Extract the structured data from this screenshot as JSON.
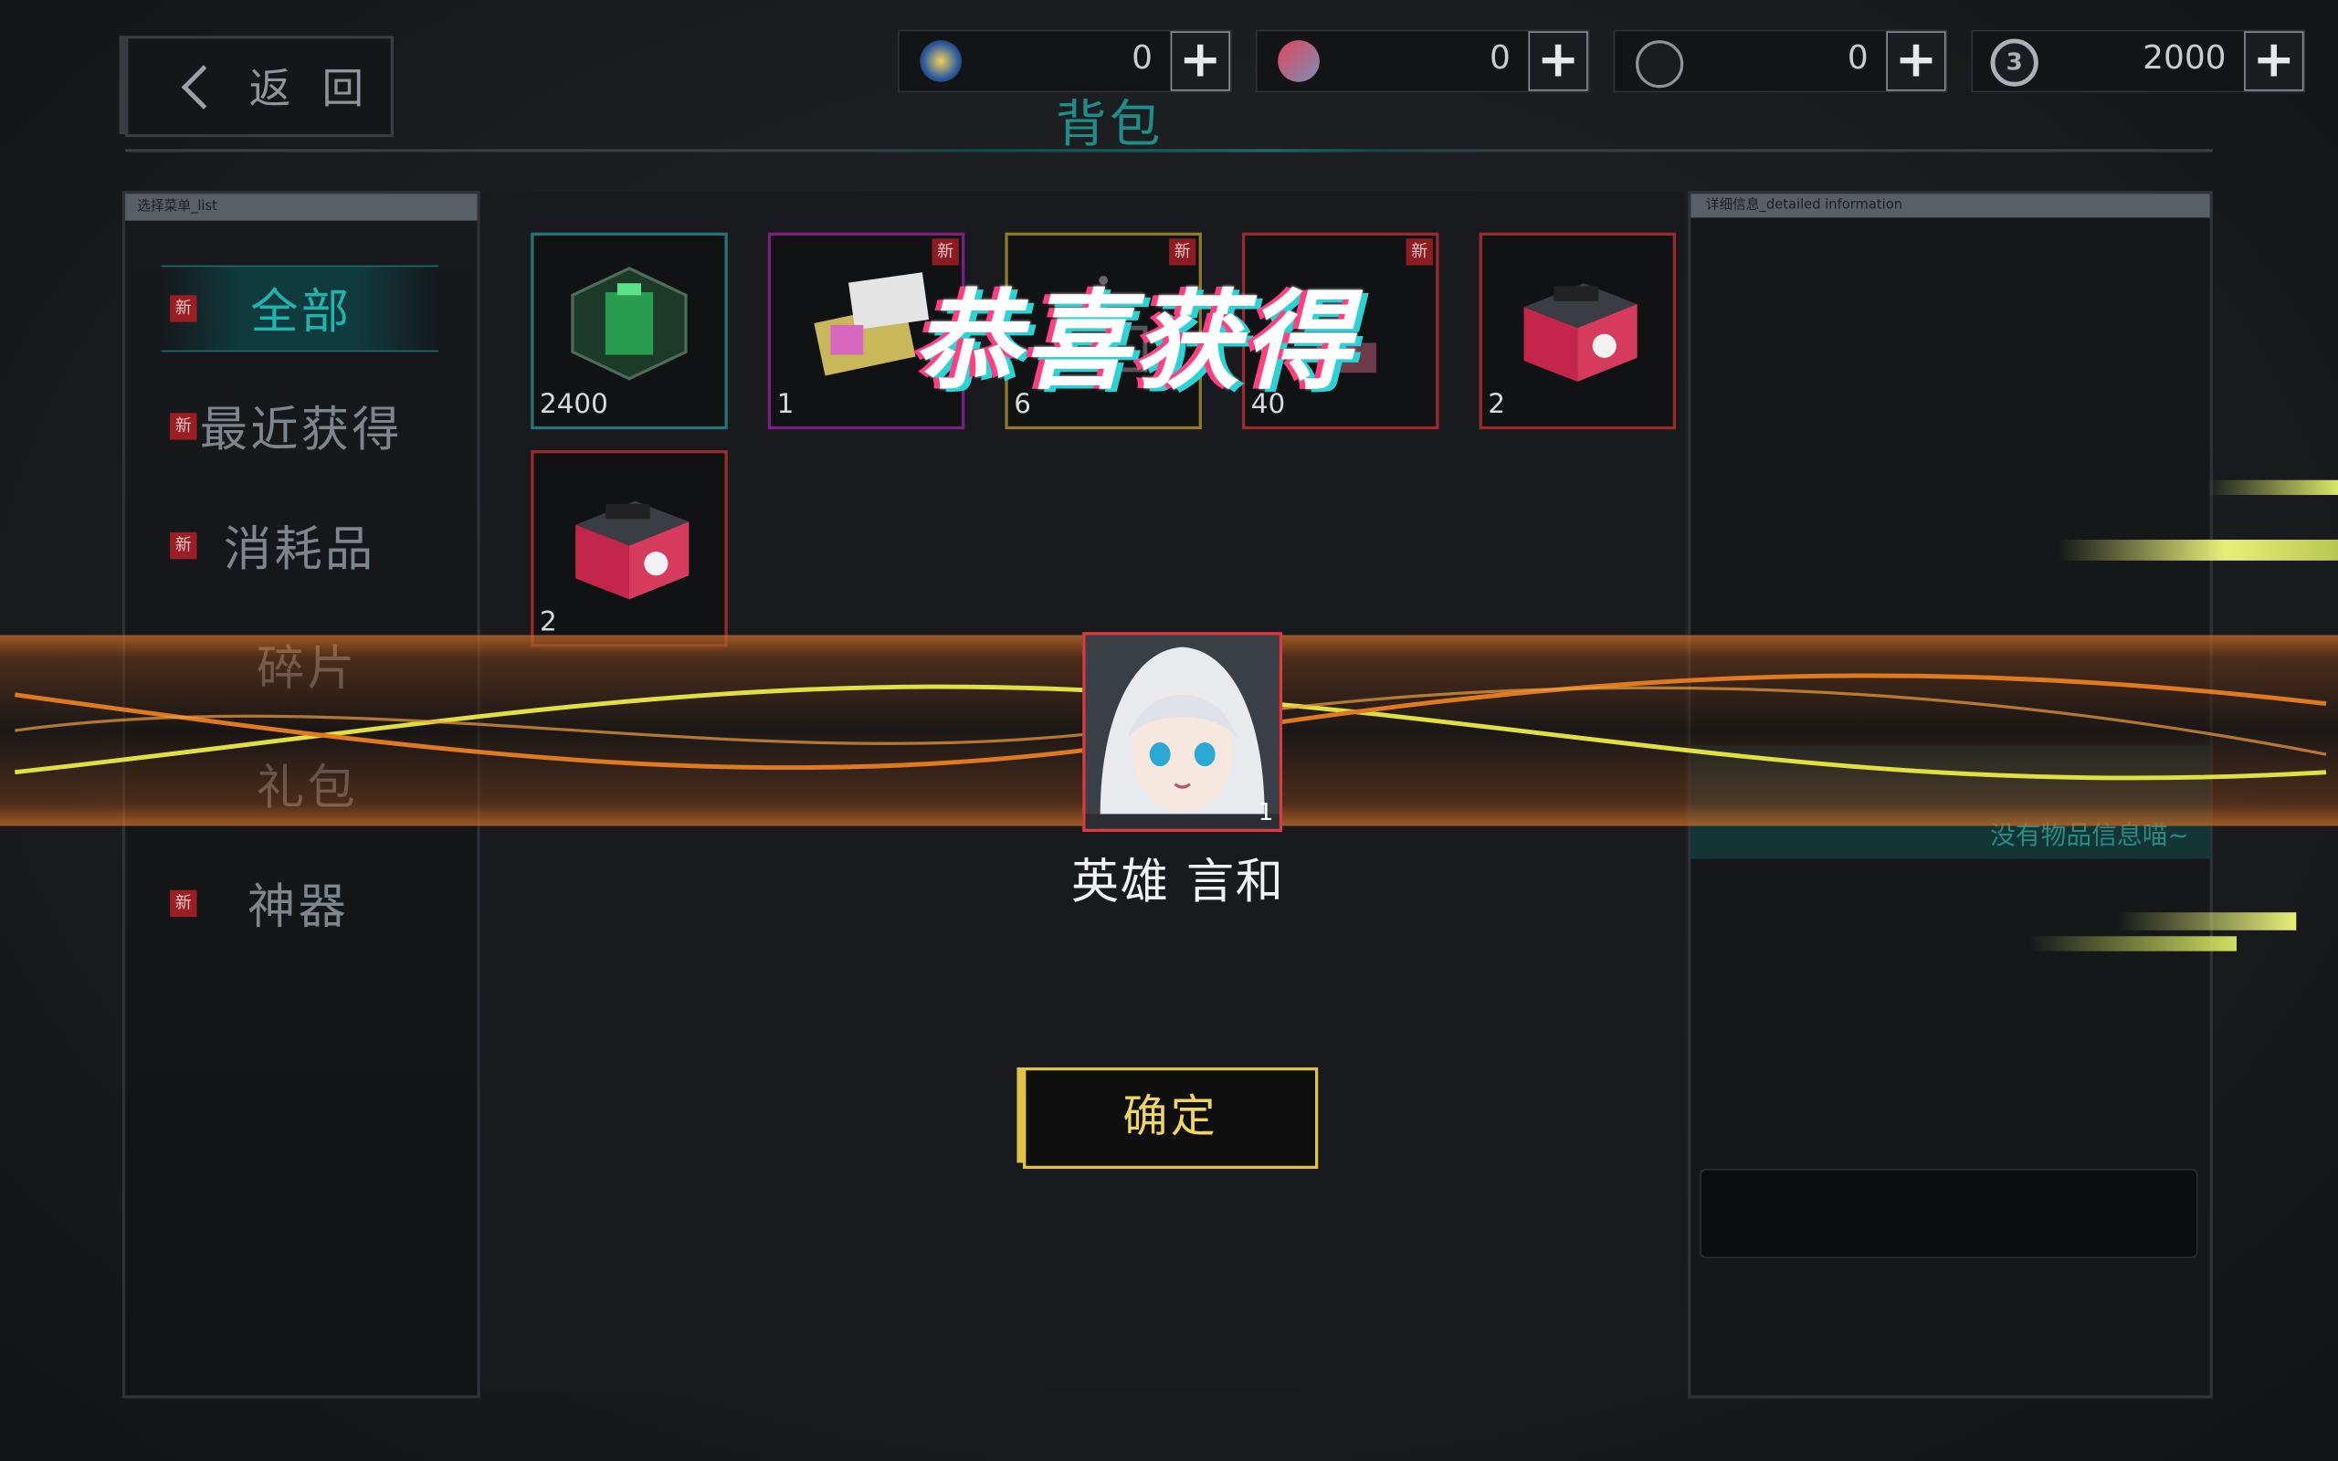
{
  "header": {
    "back_label": "返 回",
    "title": "背包"
  },
  "currencies": [
    {
      "icon": "gem-icon",
      "value": "0",
      "color": "#d2a62f"
    },
    {
      "icon": "crystal-icon",
      "value": "0",
      "color": "#d8445a"
    },
    {
      "icon": "shard-icon",
      "value": "0",
      "color": "#8d9398"
    },
    {
      "icon": "coin-icon",
      "value": "2000",
      "color": "#aab0b6"
    }
  ],
  "left_panel": {
    "header": "选择菜单_list",
    "menu": [
      {
        "label": "全部",
        "new": "新",
        "active": true
      },
      {
        "label": "最近获得",
        "new": "新"
      },
      {
        "label": "消耗品",
        "new": "新"
      },
      {
        "label": "碎片"
      },
      {
        "label": "礼包"
      },
      {
        "label": "神器",
        "new": "新"
      }
    ]
  },
  "right_panel": {
    "header": "详细信息_detailed information",
    "empty_text": "没有物品信息喵~"
  },
  "inventory": [
    {
      "count": "2400",
      "border": "#27737a",
      "art": "green-core-icon"
    },
    {
      "count": "1",
      "border": "#7a2080",
      "new": "新",
      "art": "card-icon"
    },
    {
      "count": "6",
      "border": "#8f7a2a",
      "new": "新",
      "art": "frame-icon"
    },
    {
      "count": "40",
      "border": "#9a2a2e",
      "new": "新",
      "art": "chip-icon"
    },
    {
      "count": "2",
      "border": "#9a2a2e",
      "art": "crate-icon"
    },
    {
      "count": "2",
      "border": "#9a2a2e",
      "art": "crate-icon"
    }
  ],
  "popup": {
    "congrats": "恭喜获得",
    "reward_name": "英雄 言和",
    "reward_count": "1",
    "confirm_label": "确定"
  }
}
